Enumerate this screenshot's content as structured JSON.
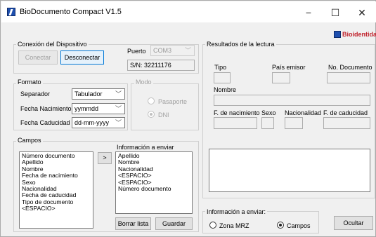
{
  "window": {
    "title": "BioDocumento Compact V1.5",
    "controls": {
      "minimize": "−",
      "maximize": "☐",
      "close": "✕"
    }
  },
  "connection": {
    "group_label": "Conexión del Dispositivo",
    "connect_label": "Conectar",
    "disconnect_label": "Desconectar",
    "port_label": "Puerto",
    "port_value": "COM3",
    "serial": "S/N: 32211176"
  },
  "format": {
    "group_label": "Formato",
    "separator_label": "Separador",
    "separator_value": "Tabulador",
    "birth_label": "Fecha Nacimiento",
    "birth_value": "yymmdd",
    "expiry_label": "Fecha Caducidad",
    "expiry_value": "dd-mm-yyyy"
  },
  "mode": {
    "group_label": "Modo",
    "passport_label": "Pasaporte",
    "dni_label": "DNI"
  },
  "fields": {
    "group_label": "Campos",
    "available": [
      "Número documento",
      "Apellido",
      "Nombre",
      "Fecha de nacimiento",
      "Sexo",
      "Nacionalidad",
      "Fecha de caducidad",
      "Tipo de documento",
      "<ESPACIO>"
    ],
    "move_label": ">",
    "send_label": "Información a enviar",
    "selected": [
      "Apellido",
      "Nombre",
      "Nacionalidad",
      "<ESPACIO>",
      "<ESPACIO>",
      "Número documento"
    ],
    "clear_label": "Borrar lista",
    "save_label": "Guardar"
  },
  "results": {
    "group_label": "Resultados de la lectura",
    "logo_text": "Bioidentidad",
    "tipo_label": "Tipo",
    "pais_label": "País emisor",
    "doc_label": "No. Documento",
    "nombre_label": "Nombre",
    "nac_label": "F. de nacimiento",
    "sexo_label": "Sexo",
    "nacionalidad_label": "Nacionalidad",
    "cad_label": "F. de caducidad"
  },
  "send": {
    "group_label": "Información a enviar:",
    "mrz_label": "Zona MRZ",
    "campos_label": "Campos",
    "hide_label": "Ocultar"
  },
  "colors": {
    "accent": "#0078d7",
    "brand": "#c0202a"
  }
}
